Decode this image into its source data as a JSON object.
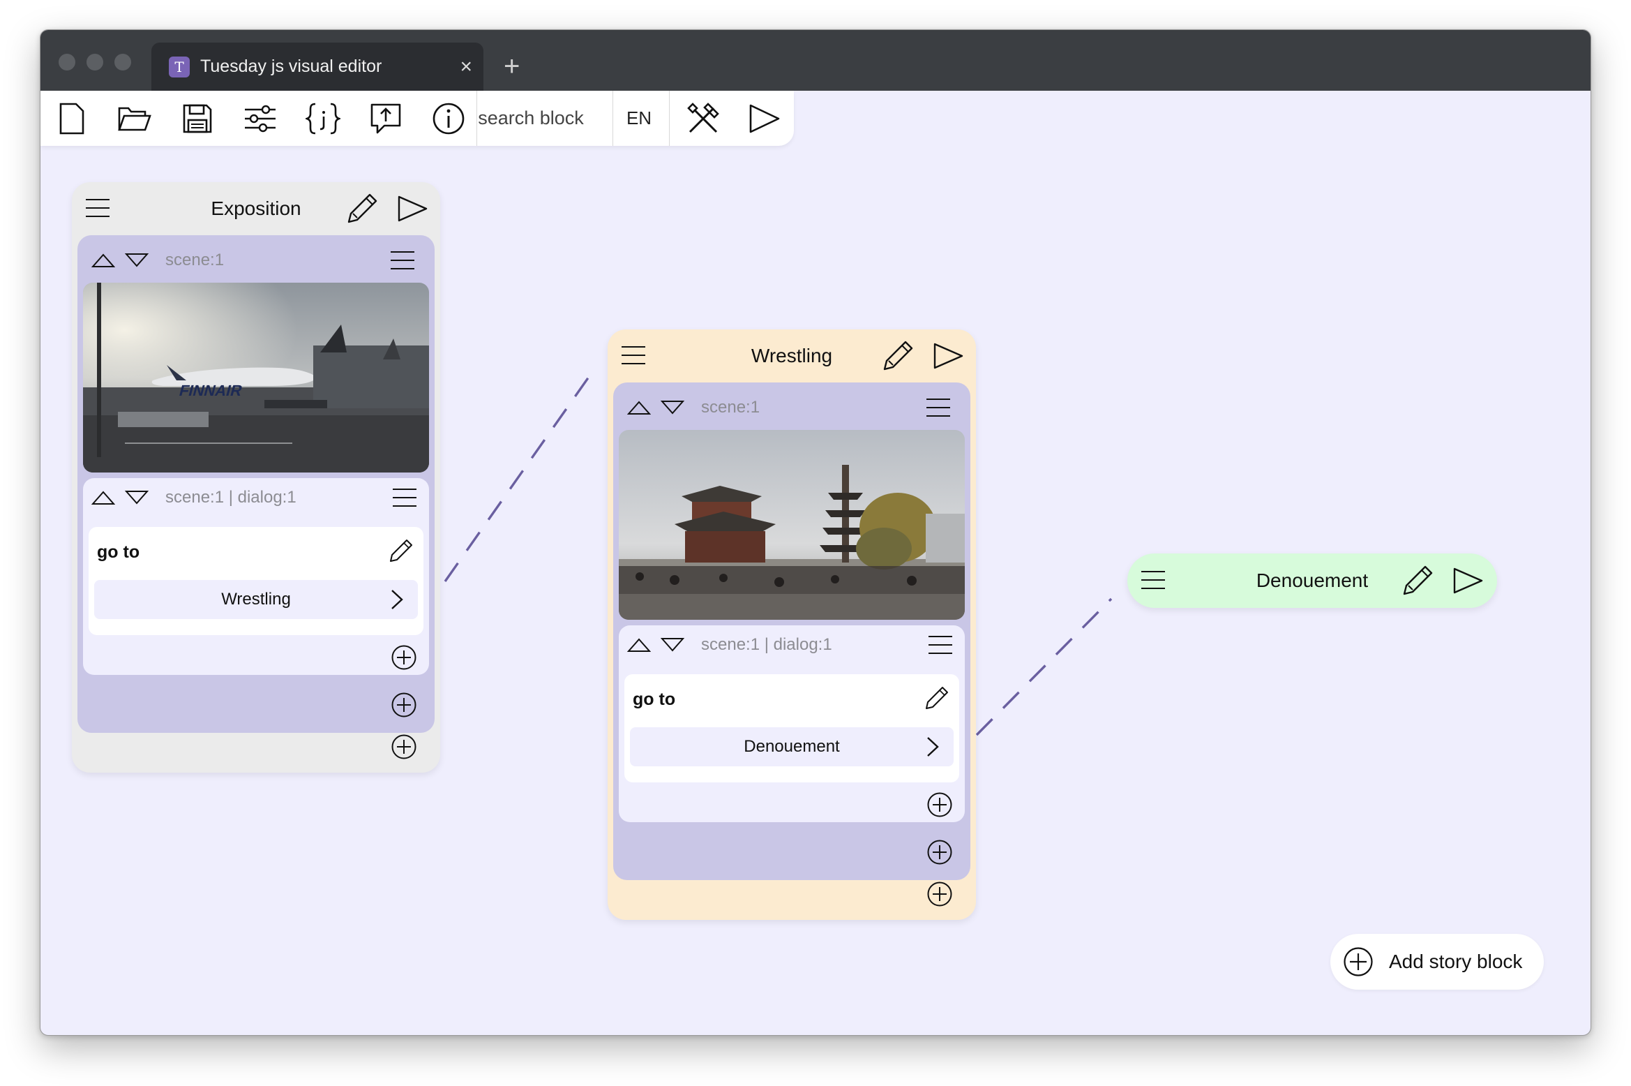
{
  "window": {
    "tab_title": "Tuesday js visual editor",
    "tab_close": "×",
    "new_tab": "+",
    "favicon_letter": "T"
  },
  "toolbar": {
    "icons": [
      "new-file-icon",
      "open-folder-icon",
      "save-icon",
      "settings-sliders-icon",
      "json-braces-icon",
      "export-upload-icon",
      "info-icon"
    ],
    "search_placeholder": "search block",
    "language": "EN",
    "tools_icon": "tools-icon",
    "play_icon": "play-icon"
  },
  "blocks": [
    {
      "title": "Exposition",
      "color": "#ebebeb",
      "scene_label": "scene:1",
      "image": "airport-plane-photo",
      "dialog_label": "scene:1 | dialog:1",
      "goto_label": "go to",
      "goto_target": "Wrestling"
    },
    {
      "title": "Wrestling",
      "color": "#fcebd0",
      "scene_label": "scene:1",
      "image": "temple-pagoda-photo",
      "dialog_label": "scene:1 | dialog:1",
      "goto_label": "go to",
      "goto_target": "Denouement"
    },
    {
      "title": "Denouement",
      "color": "#d7fbdb"
    }
  ],
  "colors": {
    "canvas": "#efeefd",
    "scene": "#c9c6e6",
    "connector": "#6a5fa0"
  },
  "add_story_block": "Add story block"
}
